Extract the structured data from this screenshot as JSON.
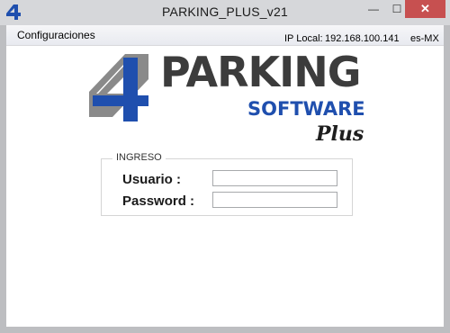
{
  "window": {
    "title": "PARKING_PLUS_v21",
    "app_icon": "four-logo-icon",
    "buttons": {
      "minimize": "—",
      "maximize": "☐",
      "close": "✕"
    }
  },
  "menubar": {
    "items": [
      {
        "label": "Configuraciones"
      }
    ],
    "ip_label": "IP Local:",
    "ip_value": "192.168.100.141",
    "locale": "es-MX"
  },
  "logo": {
    "word1": "PARKING",
    "word2": "SOFTWARE",
    "word3": "Plus",
    "colors": {
      "dark": "#3c3c3c",
      "blue": "#1f4fae",
      "grey": "#8a8a8a"
    }
  },
  "login": {
    "group_label": "INGRESO",
    "user_label": "Usuario :",
    "user_value": "",
    "password_label": "Password :",
    "password_value": ""
  }
}
